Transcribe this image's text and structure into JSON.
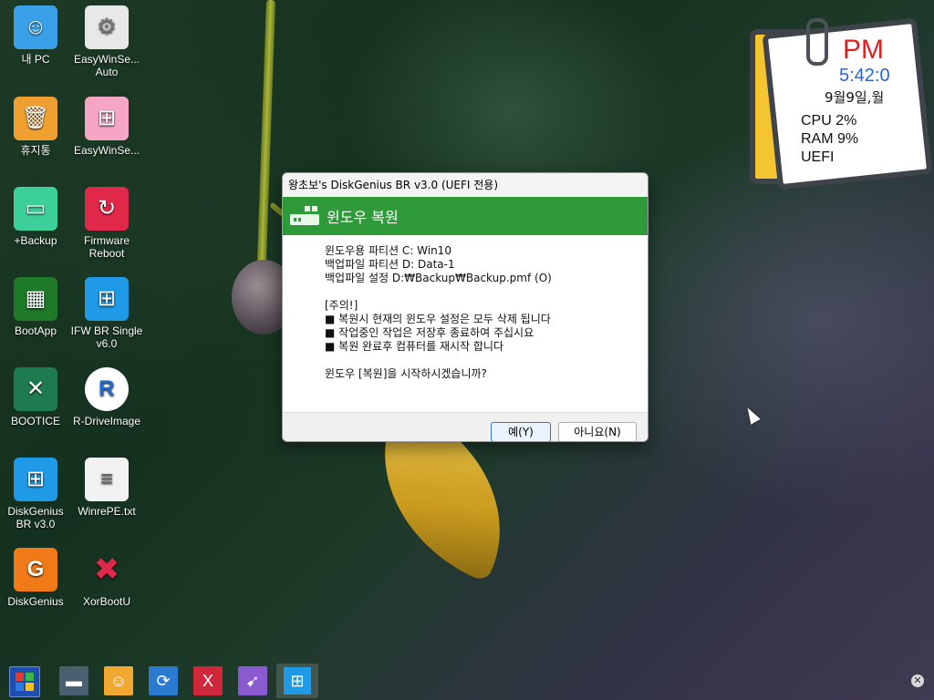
{
  "desktop": {
    "icons": [
      {
        "label": "내 PC"
      },
      {
        "label": "EasyWinSe... Auto"
      },
      {
        "label": "휴지통"
      },
      {
        "label": "EasyWinSe..."
      },
      {
        "label": "+Backup"
      },
      {
        "label": "Firmware Reboot"
      },
      {
        "label": "BootApp"
      },
      {
        "label": "IFW BR Single v6.0"
      },
      {
        "label": "BOOTICE"
      },
      {
        "label": "R-DriveImage"
      },
      {
        "label": "DiskGenius BR v3.0"
      },
      {
        "label": "WinrePE.txt"
      },
      {
        "label": "DiskGenius"
      },
      {
        "label": "XorBootU"
      }
    ]
  },
  "widget": {
    "ampm": "PM",
    "time": "5:42:0",
    "date": "9월9일,월",
    "cpu": "CPU  2%",
    "ram": "RAM  9%",
    "boot": "UEFI"
  },
  "dialog": {
    "title": "왕초보's DiskGenius BR v3.0 (UEFI 전용)",
    "header": "윈도우 복원",
    "lines": [
      "윈도우용 파티션  C:  Win10",
      "백업파일 파티션  D:  Data-1",
      "백업파일 설정  D:₩Backup₩Backup.pmf (O)",
      "",
      "[주의!]",
      "■ 복원시 현재의 윈도우 설정은 모두 삭제 됩니다",
      "■ 작업중인 작업은 저장후 종료하여 주십시요",
      "■ 복원 완료후 컴퓨터를 재시작 합니다",
      "",
      "윈도우 [복원]을  시작하시겠습니까?"
    ],
    "yes": "예(Y)",
    "no": "아니요(N)"
  },
  "taskbar": {
    "items": [
      "start-icon",
      "window-icon",
      "user-icon",
      "sync-icon",
      "x-icon",
      "rocket-icon",
      "windows-icon"
    ],
    "close_glyph": "✕"
  },
  "colors": {
    "accent": "#2f9a3a",
    "primary_btn": "#2a78d0"
  }
}
